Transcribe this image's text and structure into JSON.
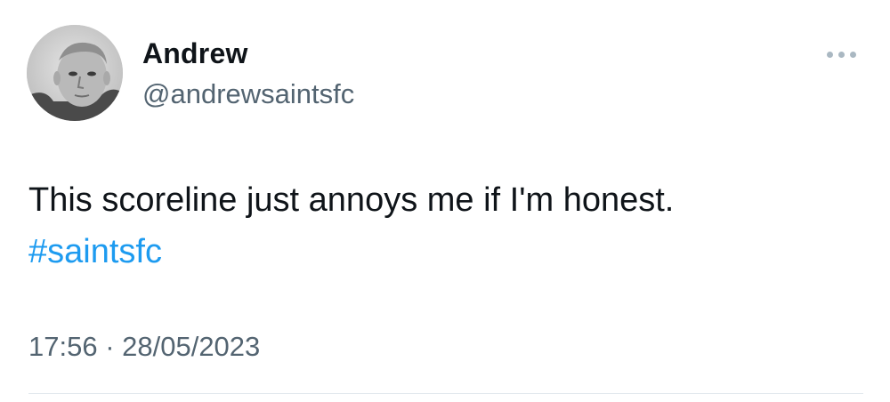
{
  "user": {
    "display_name": "Andrew",
    "handle": "@andrewsaintsfc",
    "avatar_icon": "user-avatar"
  },
  "tweet": {
    "text": "This scoreline just annoys me if I'm honest.",
    "hashtag": "#saintsfc",
    "timestamp": "17:56 · 28/05/2023"
  },
  "icons": {
    "more_options": "more-horizontal-icon"
  },
  "colors": {
    "text_primary": "#0f1419",
    "text_secondary": "#536471",
    "link": "#1d9bf0",
    "divider": "#e1e8ed"
  }
}
